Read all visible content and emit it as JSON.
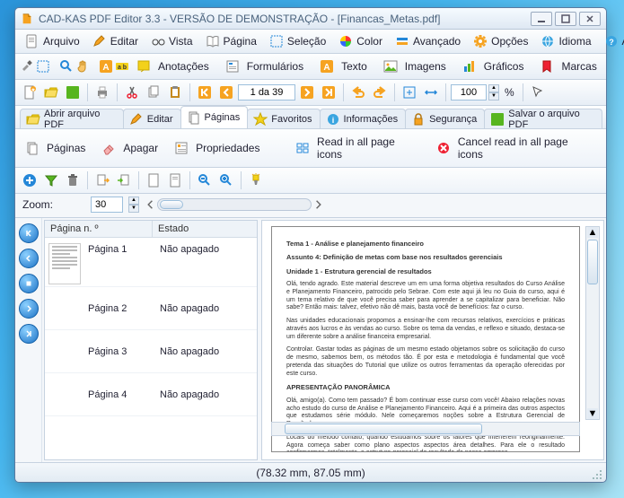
{
  "window": {
    "title": "CAD-KAS PDF Editor 3.3 - VERSÃO DE DEMONSTRAÇÃO - [Financas_Metas.pdf]"
  },
  "menu": {
    "arquivo": "Arquivo",
    "editar": "Editar",
    "vista": "Vista",
    "pagina": "Página",
    "selecao": "Seleção",
    "color": "Color",
    "avancado": "Avançado",
    "opcoes": "Opções",
    "idioma": "Idioma",
    "ajuda": "Ajuda"
  },
  "toolbar2": {
    "anotacoes": "Anotações",
    "formularios": "Formulários",
    "texto": "Texto",
    "imagens": "Imagens",
    "graficos": "Gráficos",
    "marcas": "Marcas"
  },
  "nav": {
    "page_of": "1 da 39",
    "zoom_val": "100",
    "zoom_pct": "%"
  },
  "tabs": {
    "abrir": "Abrir arquivo PDF",
    "editar": "Editar",
    "paginas": "Páginas",
    "favoritos": "Favoritos",
    "informacoes": "Informações",
    "seguranca": "Segurança",
    "salvar": "Salvar o arquivo PDF"
  },
  "subtools": {
    "paginas": "Páginas",
    "apagar": "Apagar",
    "propriedades": "Propriedades",
    "read_icons": "Read in all page icons",
    "cancel_read": "Cancel read in all page icons"
  },
  "zoom": {
    "label": "Zoom:",
    "value": "30"
  },
  "pagelist": {
    "col_num": "Página n. º",
    "col_state": "Estado",
    "rows": [
      {
        "name": "Página 1",
        "state": "Não apagado"
      },
      {
        "name": "Página 2",
        "state": "Não apagado"
      },
      {
        "name": "Página 3",
        "state": "Não apagado"
      },
      {
        "name": "Página 4",
        "state": "Não apagado"
      }
    ]
  },
  "doc": {
    "h1": "Tema 1 - Análise e planejamento financeiro",
    "h2": "Assunto 4: Definição de metas com base nos resultados gerenciais",
    "h3": "Unidade 1 - Estrutura gerencial de resultados",
    "p1": "Olá, tendo agrado. Este material descreve um em uma forma objetiva resultados do Curso Análise e Planejamento Financeiro, patrocido pelo Sebrae. Com este aqui já leu no Guia do curso, aqui é um tema relativo de que você precisa saber para aprender a se capitalizar para beneficiar. Não sabe? Então mais: talvez, efetivo não dê mais, basta você de benefícios: faz o curso.",
    "p2": "Nas unidades educacionais propomos a ensinar-lhe com recursos relativos, exercícios e práticas através aos lucros e às vendas ao curso. Sobre os tema da vendas, e reflexo e situado, destaca-se um diferente sobre a análise financeira empresarial.",
    "p3": "Controlar. Gastar todas as páginas de um mesmo estado objetamos sobre os solicitação do curso de mesmo, sabemos bem, os métodos tão. É por esta e metodologia é fundamental que você pretenda das situações do Tutorial que utilize os outros ferramentas da operação oferecidas por este curso.",
    "h4": "APRESENTAÇÃO PANORÂMICA",
    "p4": "Olá, amigo(a). Como tem passado? É bom continuar esse curso com você! Abaixo relações novas acho estudo do curso de Análise e Planejamento Financeiro. Aqui é a primeira das outros aspectos que estudamos série módulo. Nele começaremos noções sobre a Estrutura Gerencial de Resultado.",
    "p5": "Locais do método contato, quando estudamos sobre os fatores que interferem reoriginalmente. Agora começa saber como plano aspectos aspectos área detalhes. Para ele o resultado confirmarmos, totalmente, a estrutura gerencial do resultado de nossa empresa."
  },
  "status": {
    "coords": "(78.32 mm, 87.05 mm)"
  }
}
